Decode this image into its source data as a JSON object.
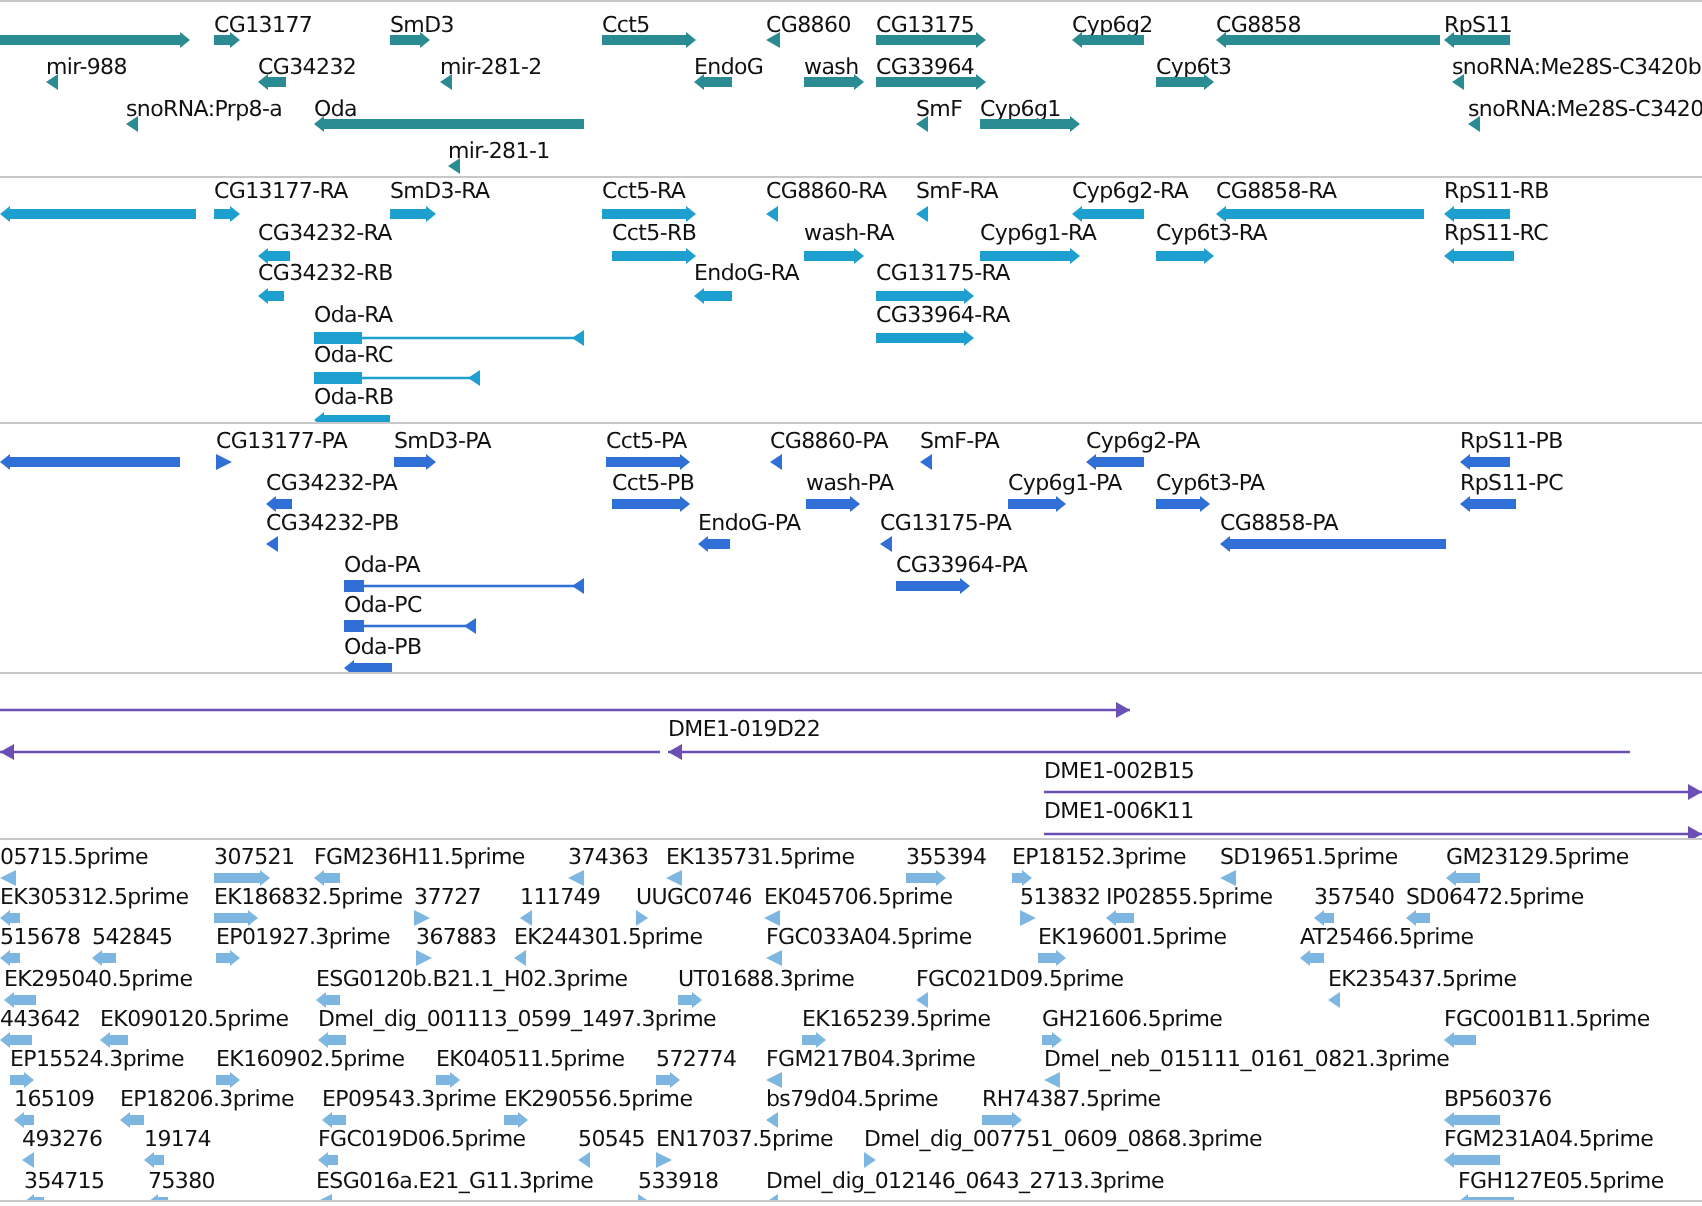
{
  "tracks": [
    {
      "kind": "gene",
      "rows": [
        {
          "features": [
            {
              "reverse": false
            },
            {
              "label": "CG13177",
              "reverse": false
            },
            {
              "label": "SmD3",
              "reverse": false
            },
            {
              "label": "Cct5",
              "reverse": false
            },
            {
              "label": "CG8860",
              "reverse": true
            },
            {
              "label": "CG13175",
              "reverse": false
            },
            {
              "label": "Cyp6g2",
              "reverse": true
            },
            {
              "label": "CG8858",
              "reverse": true
            },
            {
              "label": "RpS11",
              "reverse": true
            }
          ]
        },
        {
          "features": [
            {
              "label": "mir-988",
              "reverse": true
            },
            {
              "label": "CG34232",
              "reverse": true
            },
            {
              "label": "mir-281-2",
              "reverse": true
            },
            {
              "label": "EndoG",
              "reverse": true
            },
            {
              "label": "wash",
              "reverse": false
            },
            {
              "label": "CG33964",
              "reverse": false
            },
            {
              "label": "Cyp6t3",
              "reverse": false
            },
            {
              "label": "snoRNA:Me28S-C3420b",
              "reverse": true
            }
          ]
        },
        {
          "features": [
            {
              "label": "snoRNA:Prp8-a",
              "reverse": true
            },
            {
              "label": "Oda",
              "reverse": true
            },
            {
              "label": "SmF",
              "reverse": true
            },
            {
              "label": "Cyp6g1",
              "reverse": false
            },
            {
              "label": "snoRNA:Me28S-C3420",
              "reverse": true
            }
          ]
        },
        {
          "features": [
            {
              "label": "mir-281-1",
              "reverse": true
            }
          ]
        }
      ]
    },
    {
      "kind": "transcript",
      "rows": [
        {
          "features": [
            {
              "reverse": true
            },
            {
              "label": "CG13177-RA",
              "reverse": false
            },
            {
              "label": "SmD3-RA",
              "reverse": false
            },
            {
              "label": "Cct5-RA",
              "reverse": false
            },
            {
              "label": "CG8860-RA",
              "reverse": true
            },
            {
              "label": "SmF-RA",
              "reverse": true
            },
            {
              "label": "Cyp6g2-RA",
              "reverse": true
            },
            {
              "label": "CG8858-RA",
              "reverse": true
            },
            {
              "label": "RpS11-RB",
              "reverse": true
            }
          ]
        },
        {
          "features": [
            {
              "label": "CG34232-RA",
              "reverse": true
            },
            {
              "label": "Cct5-RB",
              "reverse": false
            },
            {
              "label": "wash-RA",
              "reverse": false
            },
            {
              "label": "Cyp6g1-RA",
              "reverse": false
            },
            {
              "label": "Cyp6t3-RA",
              "reverse": false
            },
            {
              "label": "RpS11-RC",
              "reverse": true
            }
          ]
        },
        {
          "features": [
            {
              "label": "CG34232-RB",
              "reverse": true
            },
            {
              "label": "EndoG-RA",
              "reverse": true
            },
            {
              "label": "CG13175-RA",
              "reverse": false
            }
          ]
        },
        {
          "features": [
            {
              "label": "Oda-RA",
              "reverse": true
            },
            {
              "label": "CG33964-RA",
              "reverse": false
            }
          ]
        },
        {
          "features": [
            {
              "label": "Oda-RC",
              "reverse": true
            }
          ]
        },
        {
          "features": [
            {
              "label": "Oda-RB",
              "reverse": true
            }
          ]
        }
      ]
    },
    {
      "kind": "protein",
      "rows": [
        {
          "features": [
            {
              "reverse": true
            },
            {
              "label": "CG13177-PA",
              "reverse": false
            },
            {
              "label": "SmD3-PA",
              "reverse": false
            },
            {
              "label": "Cct5-PA",
              "reverse": false
            },
            {
              "label": "CG8860-PA",
              "reverse": true
            },
            {
              "label": "SmF-PA",
              "reverse": true
            },
            {
              "label": "Cyp6g2-PA",
              "reverse": true
            },
            {
              "label": "RpS11-PB",
              "reverse": true
            }
          ]
        },
        {
          "features": [
            {
              "label": "CG34232-PA",
              "reverse": true
            },
            {
              "label": "Cct5-PB",
              "reverse": false
            },
            {
              "label": "wash-PA",
              "reverse": false
            },
            {
              "label": "Cyp6g1-PA",
              "reverse": false
            },
            {
              "label": "Cyp6t3-PA",
              "reverse": false
            },
            {
              "label": "RpS11-PC",
              "reverse": true
            }
          ]
        },
        {
          "features": [
            {
              "label": "CG34232-PB",
              "reverse": true
            },
            {
              "label": "EndoG-PA",
              "reverse": true
            },
            {
              "label": "CG13175-PA",
              "reverse": true
            },
            {
              "label": "CG8858-PA",
              "reverse": true
            }
          ]
        },
        {
          "features": [
            {
              "label": "Oda-PA",
              "reverse": true
            },
            {
              "label": "CG33964-PA",
              "reverse": false
            }
          ]
        },
        {
          "features": [
            {
              "label": "Oda-PC",
              "reverse": true
            }
          ]
        },
        {
          "features": [
            {
              "label": "Oda-PB",
              "reverse": true
            }
          ]
        }
      ]
    },
    {
      "kind": "bac",
      "rows": [
        {
          "features": [
            {
              "reverse": false
            }
          ]
        },
        {
          "features": [
            {
              "reverse": true
            },
            {
              "label": "DME1-019D22",
              "reverse": true
            }
          ]
        },
        {
          "features": [
            {
              "label": "DME1-002B15",
              "reverse": false
            }
          ]
        },
        {
          "features": [
            {
              "label": "DME1-006K11",
              "reverse": false
            }
          ]
        }
      ]
    },
    {
      "kind": "est",
      "rows": [
        {
          "features": [
            {
              "label": "05715.5prime",
              "reverse": true
            },
            {
              "label": "307521",
              "reverse": false
            },
            {
              "label": "FGM236H11.5prime",
              "reverse": true
            },
            {
              "label": "374363",
              "reverse": true
            },
            {
              "label": "EK135731.5prime",
              "reverse": true
            },
            {
              "label": "355394",
              "reverse": false
            },
            {
              "label": "EP18152.3prime",
              "reverse": false
            },
            {
              "label": "SD19651.5prime",
              "reverse": true
            },
            {
              "label": "GM23129.5prime",
              "reverse": true
            }
          ]
        },
        {
          "features": [
            {
              "label": "EK305312.5prime",
              "reverse": true
            },
            {
              "label": "EK186832.5prime",
              "reverse": false
            },
            {
              "label": "37727",
              "reverse": false
            },
            {
              "label": "111749",
              "reverse": true
            },
            {
              "label": "UUGC0746",
              "reverse": false
            },
            {
              "label": "EK045706.5prime",
              "reverse": true
            },
            {
              "label": "513832",
              "reverse": false
            },
            {
              "label": "IP02855.5prime",
              "reverse": true
            },
            {
              "label": "357540",
              "reverse": true
            },
            {
              "label": "SD06472.5prime",
              "reverse": true
            }
          ]
        },
        {
          "features": [
            {
              "label": "515678",
              "reverse": true
            },
            {
              "label": "542845",
              "reverse": true
            },
            {
              "label": "EP01927.3prime",
              "reverse": false
            },
            {
              "label": "367883",
              "reverse": false
            },
            {
              "label": "EK244301.5prime",
              "reverse": true
            },
            {
              "label": "FGC033A04.5prime",
              "reverse": true
            },
            {
              "label": "EK196001.5prime",
              "reverse": false
            },
            {
              "label": "AT25466.5prime",
              "reverse": true
            }
          ]
        },
        {
          "features": [
            {
              "label": "EK295040.5prime",
              "reverse": true
            },
            {
              "label": "ESG0120b.B21.1_H02.3prime",
              "reverse": true
            },
            {
              "label": "UT01688.3prime",
              "reverse": false
            },
            {
              "label": "FGC021D09.5prime",
              "reverse": true
            },
            {
              "label": "EK235437.5prime",
              "reverse": true
            }
          ]
        },
        {
          "features": [
            {
              "label": "443642",
              "reverse": true
            },
            {
              "label": "EK090120.5prime",
              "reverse": true
            },
            {
              "label": "Dmel_dig_001113_0599_1497.3prime",
              "reverse": true
            },
            {
              "label": "EK165239.5prime",
              "reverse": false
            },
            {
              "label": "GH21606.5prime",
              "reverse": false
            },
            {
              "label": "FGC001B11.5prime",
              "reverse": true
            }
          ]
        },
        {
          "features": [
            {
              "label": "EP15524.3prime",
              "reverse": false
            },
            {
              "label": "EK160902.5prime",
              "reverse": false
            },
            {
              "label": "EK040511.5prime",
              "reverse": false
            },
            {
              "label": "572774",
              "reverse": false
            },
            {
              "label": "FGM217B04.3prime",
              "reverse": true
            },
            {
              "label": "Dmel_neb_015111_0161_0821.3prime",
              "reverse": true
            }
          ]
        },
        {
          "features": [
            {
              "label": "165109",
              "reverse": true
            },
            {
              "label": "EP18206.3prime",
              "reverse": true
            },
            {
              "label": "EP09543.3prime",
              "reverse": true
            },
            {
              "label": "EK290556.5prime",
              "reverse": false
            },
            {
              "label": "bs79d04.5prime",
              "reverse": true
            },
            {
              "label": "RH74387.5prime",
              "reverse": false
            },
            {
              "label": "BP560376",
              "reverse": true
            }
          ]
        },
        {
          "features": [
            {
              "label": "493276",
              "reverse": true
            },
            {
              "label": "19174",
              "reverse": true
            },
            {
              "label": "FGC019D06.5prime",
              "reverse": true
            },
            {
              "label": "50545",
              "reverse": true
            },
            {
              "label": "EN17037.5prime",
              "reverse": false
            },
            {
              "label": "Dmel_dig_007751_0609_0868.3prime",
              "reverse": false
            },
            {
              "label": "FGM231A04.5prime",
              "reverse": true
            }
          ]
        },
        {
          "features": [
            {
              "label": "354715",
              "reverse": true
            },
            {
              "label": "75380",
              "reverse": true
            },
            {
              "label": "ESG016a.E21_G11.3prime",
              "reverse": true
            },
            {
              "label": "533918",
              "reverse": false
            },
            {
              "label": "Dmel_dig_012146_0643_2713.3prime",
              "reverse": true
            },
            {
              "label": "FGH127E05.5prime",
              "reverse": true
            }
          ]
        }
      ]
    }
  ]
}
